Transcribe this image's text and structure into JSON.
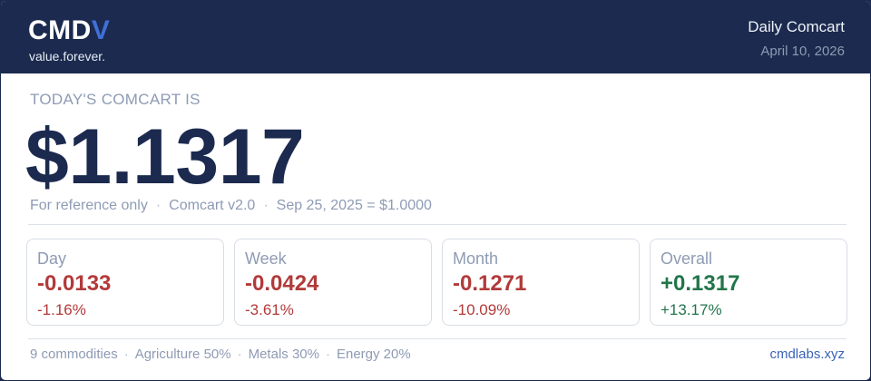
{
  "header": {
    "brand_main": "CMD",
    "brand_accent": "V",
    "tagline": "value.forever.",
    "title": "Daily Comcart",
    "date": "April 10, 2026"
  },
  "main": {
    "kicker": "TODAY'S COMCART IS",
    "price": "$1.1317",
    "reference": [
      "For reference only",
      "Comcart v2.0",
      "Sep 25, 2025 = $1.0000"
    ]
  },
  "tiles": [
    {
      "label": "Day",
      "change": "-0.0133",
      "percent": "-1.16%",
      "direction": "down"
    },
    {
      "label": "Week",
      "change": "-0.0424",
      "percent": "-3.61%",
      "direction": "down"
    },
    {
      "label": "Month",
      "change": "-0.1271",
      "percent": "-10.09%",
      "direction": "down"
    },
    {
      "label": "Overall",
      "change": "+0.1317",
      "percent": "+13.17%",
      "direction": "up"
    }
  ],
  "footer": {
    "items": [
      "9 commodities",
      "Agriculture 50%",
      "Metals 30%",
      "Energy 20%"
    ],
    "site": "cmdlabs.xyz"
  },
  "colors": {
    "navy": "#1b2a4e",
    "accent": "#3f6fd8",
    "negative": "#b23a3a",
    "positive": "#22754a"
  }
}
